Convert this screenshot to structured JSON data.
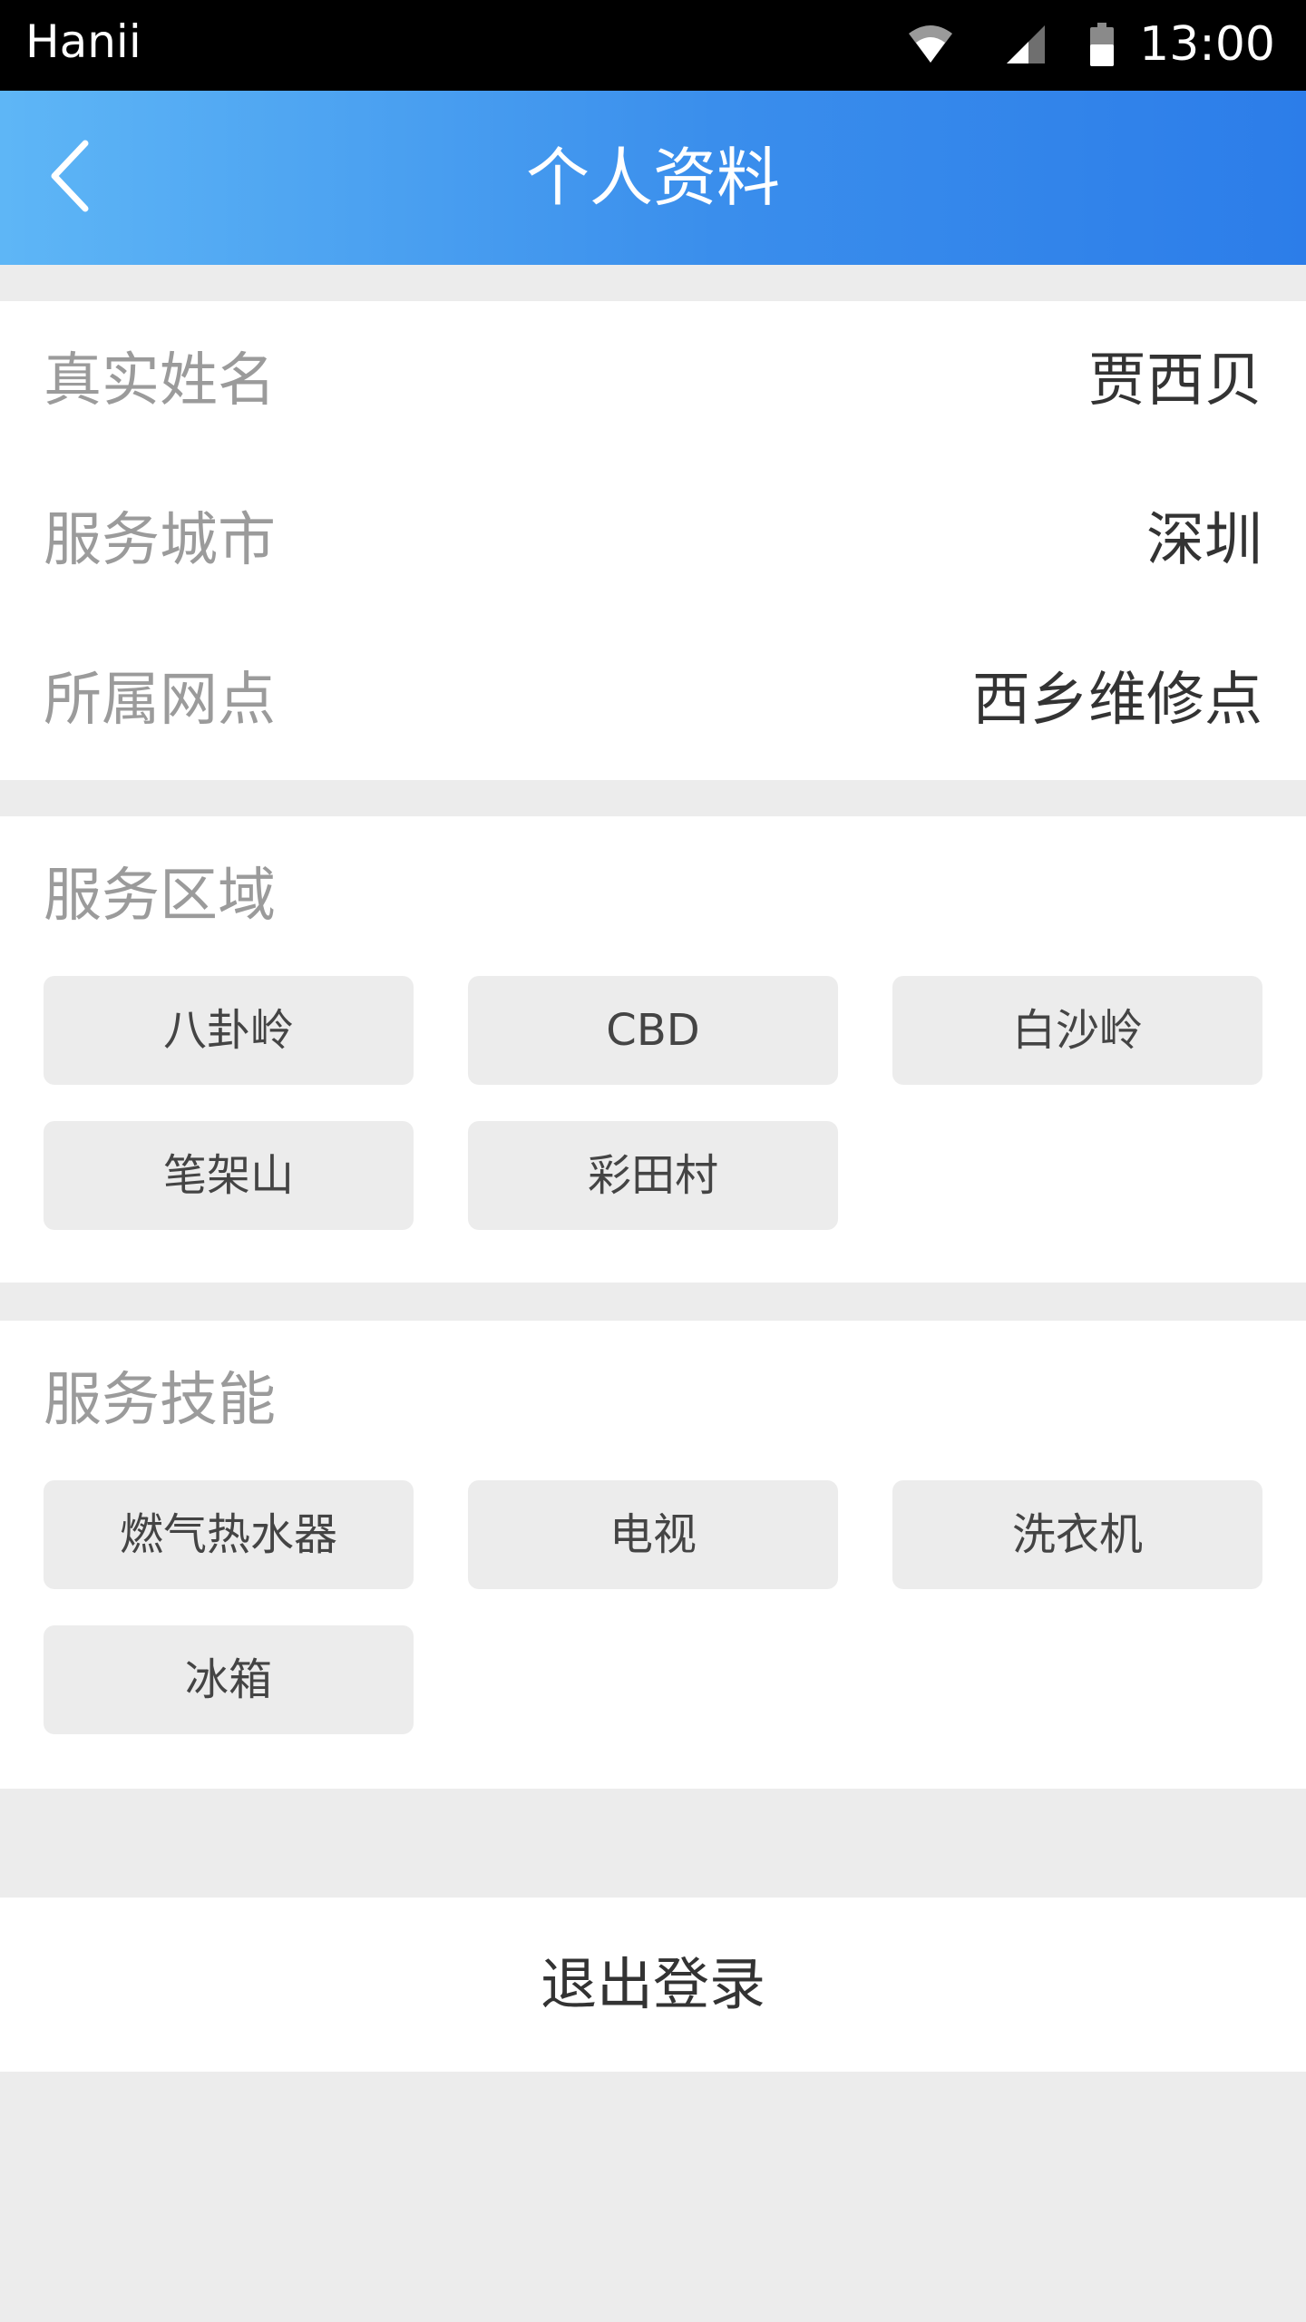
{
  "status_bar": {
    "carrier": "Hanii",
    "time": "13:00",
    "icons": [
      "wifi-icon",
      "signal-icon",
      "battery-icon"
    ]
  },
  "nav": {
    "back_icon": "chevron-left-icon",
    "title": "个人资料"
  },
  "profile": {
    "name_label": "真实姓名",
    "name_value": "贾西贝",
    "city_label": "服务城市",
    "city_value": "深圳",
    "outlet_label": "所属网点",
    "outlet_value": "西乡维修点"
  },
  "service_area": {
    "title": "服务区域",
    "tags": [
      "八卦岭",
      "CBD",
      "白沙岭",
      "笔架山",
      "彩田村"
    ]
  },
  "service_skills": {
    "title": "服务技能",
    "tags": [
      "燃气热水器",
      "电视",
      "洗衣机",
      "冰箱"
    ]
  },
  "logout": {
    "label": "退出登录"
  },
  "colors": {
    "nav_gradient_start": "#5eb6f6",
    "nav_gradient_end": "#2c7de9",
    "page_background": "#ececec",
    "label_gray": "#9b9b9b",
    "value_dark": "#333333"
  }
}
